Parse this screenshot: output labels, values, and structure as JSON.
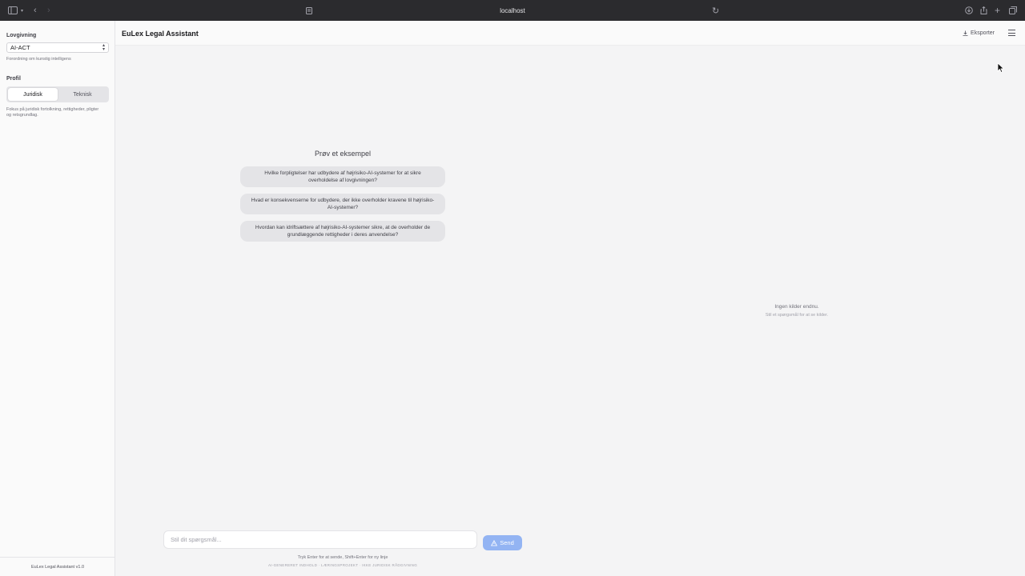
{
  "browser": {
    "url": "localhost"
  },
  "sidebar": {
    "legislation_label": "Lovgivning",
    "legislation_selected": "AI-ACT",
    "legislation_hint": "Forordning om kunstig intelligens",
    "profile_label": "Profil",
    "profile_options": [
      "Juridisk",
      "Teknisk"
    ],
    "profile_selected": "Juridisk",
    "profile_hint": "Fokus på juridisk fortolkning, rettigheder, pligter og retsgrundlag.",
    "footer": "EuLex Legal Assistant v1.0"
  },
  "header": {
    "title": "EuLex Legal Assistant",
    "export_label": "Eksporter"
  },
  "examples": {
    "title": "Prøv et eksempel",
    "items": [
      "Hvilke forpligtelser har udbydere af højrisiko-AI-systemer for at sikre overholdelse af lovgivningen?",
      "Hvad er konsekvenserne for udbydere, der ikke overholder kravene til højrisiko-AI-systemer?",
      "Hvordan kan idriftsættere af højrisiko-AI-systemer sikre, at de overholder de grundlæggende rettigheder i deres anvendelse?"
    ]
  },
  "sources": {
    "empty_title": "Ingen kilder endnu.",
    "empty_hint": "Stil et spørgsmål for at se kilder."
  },
  "composer": {
    "placeholder": "Stil dit spørgsmål...",
    "send_label": "Send",
    "hint": "Tryk Enter for at sende, Shift+Enter for ny linje",
    "disclaimer": "AI-GENERERET INDHOLD · LÆRINGSPROJEKT · IKKE JURIDISK RÅDGIVNING"
  },
  "colors": {
    "send_button": "#93b4f3",
    "chip_background": "#e4e4e7"
  }
}
